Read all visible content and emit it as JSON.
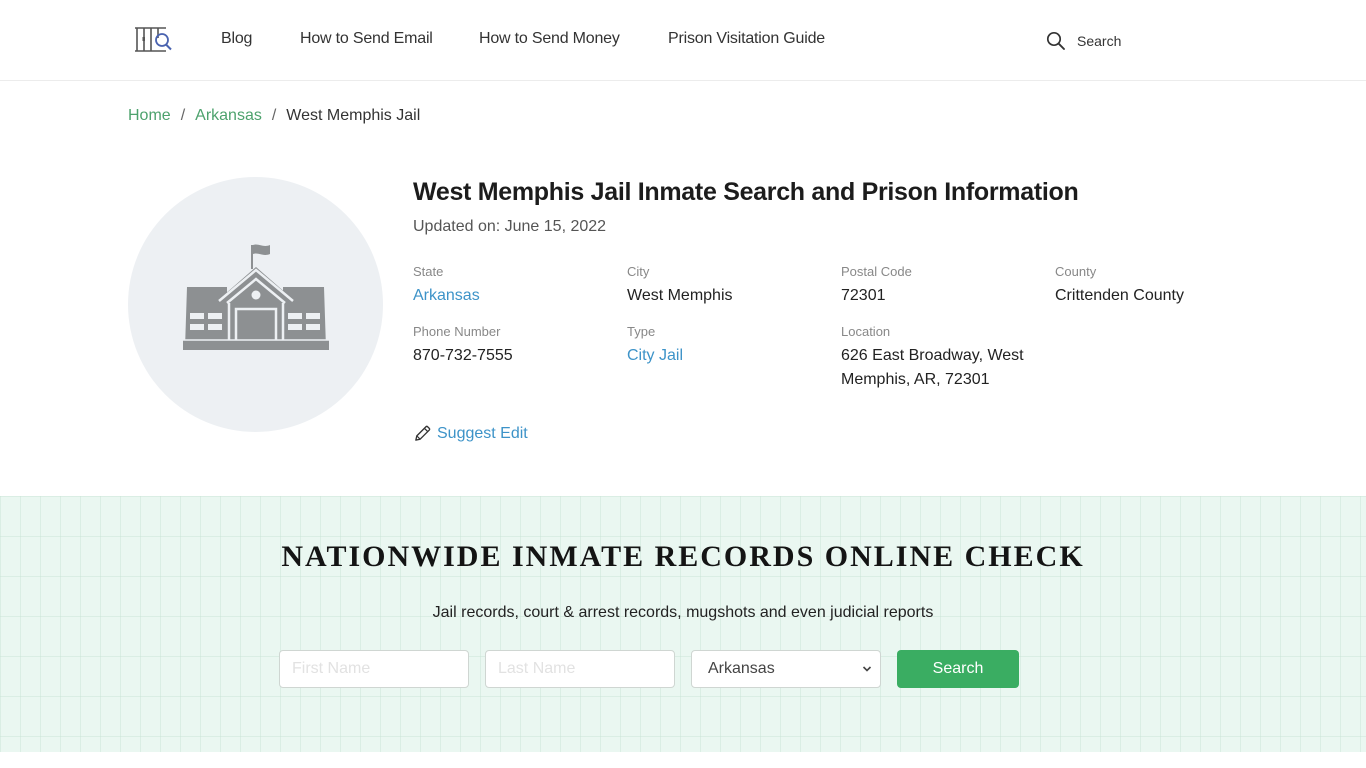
{
  "header": {
    "logo_icon": "jail-bars-magnifier-icon",
    "nav": [
      {
        "label": "Blog"
      },
      {
        "label": "How to Send Email"
      },
      {
        "label": "How to Send Money"
      },
      {
        "label": "Prison Visitation Guide"
      }
    ],
    "search": {
      "icon": "search-icon",
      "label": "Search"
    }
  },
  "breadcrumb": {
    "items": [
      {
        "label": "Home"
      },
      {
        "label": "Arkansas"
      }
    ],
    "separator": "/",
    "current": "West Memphis Jail"
  },
  "facility": {
    "image_icon": "building-icon",
    "title": "West Memphis Jail Inmate Search and Prison Information",
    "updated": "Updated on: June 15, 2022",
    "fields": [
      {
        "label": "State",
        "value": "Arkansas",
        "link": true
      },
      {
        "label": "City",
        "value": "West Memphis",
        "link": false
      },
      {
        "label": "Postal Code",
        "value": "72301",
        "link": false
      },
      {
        "label": "County",
        "value": "Crittenden County",
        "link": false
      },
      {
        "label": "Phone Number",
        "value": "870-732-7555",
        "link": false
      },
      {
        "label": "Type",
        "value": "City Jail",
        "link": true
      },
      {
        "label": "Location",
        "value": "626 East Broadway, West Memphis, AR, 72301",
        "link": false
      }
    ],
    "suggest_edit": "Suggest Edit"
  },
  "records": {
    "heading": "NATIONWIDE INMATE RECORDS ONLINE CHECK",
    "subheading": "Jail records, court & arrest records, mugshots and even judicial reports",
    "first_name_placeholder": "First Name",
    "last_name_placeholder": "Last Name",
    "first_name_value": "",
    "last_name_value": "",
    "state_selected": "Arkansas",
    "search_button": "Search"
  },
  "colors": {
    "accent_green": "#3aad62",
    "breadcrumb_link": "#4da26d",
    "info_link": "#3d93c8",
    "section_bg": "#eaf7f1"
  }
}
